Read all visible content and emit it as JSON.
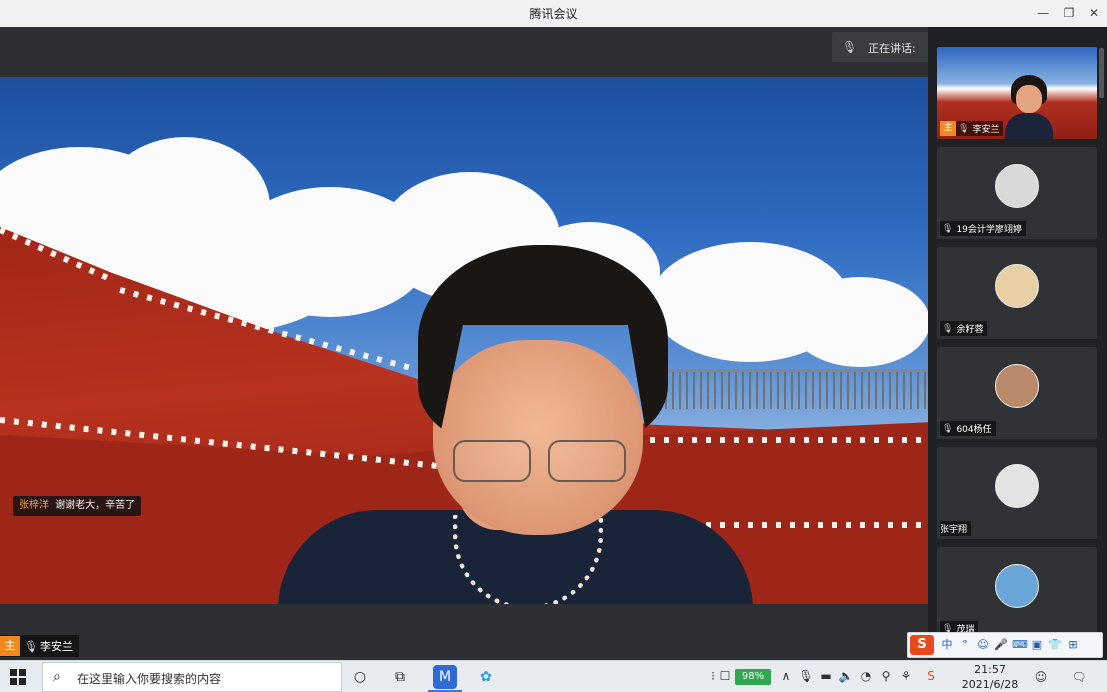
{
  "window": {
    "title": "腾讯会议",
    "minimize": "—",
    "restore": "❐",
    "close": "✕"
  },
  "speaking": {
    "label": "正在讲话:"
  },
  "main": {
    "chat": {
      "user": "张梓洋",
      "message": "谢谢老大，辛苦了"
    },
    "speaker_name": "李安兰",
    "host_badge": "主"
  },
  "participants": [
    {
      "name": "李安兰",
      "type": "video",
      "host": true
    },
    {
      "name": "19会计学廖翊婷",
      "type": "avatar",
      "avatar_color": "#d9d9d9"
    },
    {
      "name": "余籽蓉",
      "type": "avatar",
      "avatar_color": "#e8cfa4"
    },
    {
      "name": "604杨任",
      "type": "avatar",
      "avatar_color": "#b88a6a"
    },
    {
      "name": "张宇翔",
      "type": "avatar",
      "avatar_color": "#e4e4e4"
    },
    {
      "name": "茂瑞",
      "type": "avatar",
      "avatar_color": "#6aa6d8"
    }
  ],
  "taskbar": {
    "search_placeholder": "在这里输入你要搜索的内容",
    "battery": "98%",
    "time": "21:57",
    "date": "2021/6/28"
  },
  "ime": {
    "logo": "S",
    "mode": "中"
  },
  "colors": {
    "accent": "#3a7bd5",
    "host_badge": "#f08a1c",
    "chat_user": "#f0a040"
  }
}
